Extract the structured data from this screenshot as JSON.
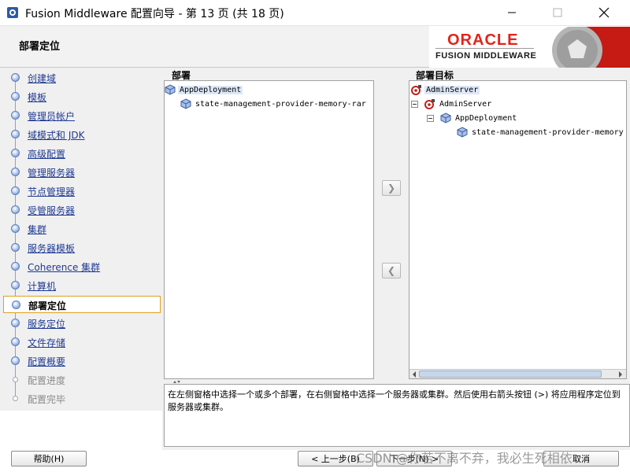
{
  "window": {
    "title": "Fusion Middleware 配置向导 - 第 13 页 (共 18 页)",
    "minimize": "—",
    "maximize": "☐",
    "close": "✕"
  },
  "header": {
    "page_title": "部署定位",
    "logo_brand": "ORACLE",
    "logo_product": "FUSION MIDDLEWARE"
  },
  "nav": {
    "items": [
      {
        "label": "创建域",
        "state": "done"
      },
      {
        "label": "模板",
        "state": "done"
      },
      {
        "label": "管理员帐户",
        "state": "done"
      },
      {
        "label": "域模式和 JDK",
        "state": "done"
      },
      {
        "label": "高级配置",
        "state": "done"
      },
      {
        "label": "管理服务器",
        "state": "done"
      },
      {
        "label": "节点管理器",
        "state": "done"
      },
      {
        "label": "受管服务器",
        "state": "done"
      },
      {
        "label": "集群",
        "state": "done"
      },
      {
        "label": "服务器模板",
        "state": "done"
      },
      {
        "label": "Coherence 集群",
        "state": "done"
      },
      {
        "label": "计算机",
        "state": "done"
      },
      {
        "label": "部署定位",
        "state": "current"
      },
      {
        "label": "服务定位",
        "state": "done"
      },
      {
        "label": "文件存储",
        "state": "done"
      },
      {
        "label": "配置概要",
        "state": "done"
      },
      {
        "label": "配置进度",
        "state": "disabled"
      },
      {
        "label": "配置完毕",
        "state": "disabled"
      }
    ]
  },
  "left_pane": {
    "label": "部署",
    "items": [
      {
        "text": "AppDeployment",
        "selected": true
      },
      {
        "text": "state-management-provider-memory-rar",
        "selected": false
      }
    ]
  },
  "right_pane": {
    "label": "部署目标",
    "items": [
      {
        "text": "AdminServer",
        "selected": true
      },
      {
        "text": "AdminServer",
        "selected": false
      },
      {
        "text": "AppDeployment",
        "selected": false
      },
      {
        "text": "state-management-provider-memory",
        "selected": false
      }
    ]
  },
  "arrows": {
    "add": "❯",
    "remove": "❮"
  },
  "description": "在左侧窗格中选择一个或多个部署，在右侧窗格中选择一个服务器或集群。然后使用右箭头按钮 (>) 将应用程序定位到服务器或集群。",
  "buttons": {
    "help": "帮助(H)",
    "back": "< 上一步(B)",
    "next": "下一步(N) >",
    "cancel": "取消"
  },
  "watermark": "CSDN @你若不离不弃，我必生死相依"
}
